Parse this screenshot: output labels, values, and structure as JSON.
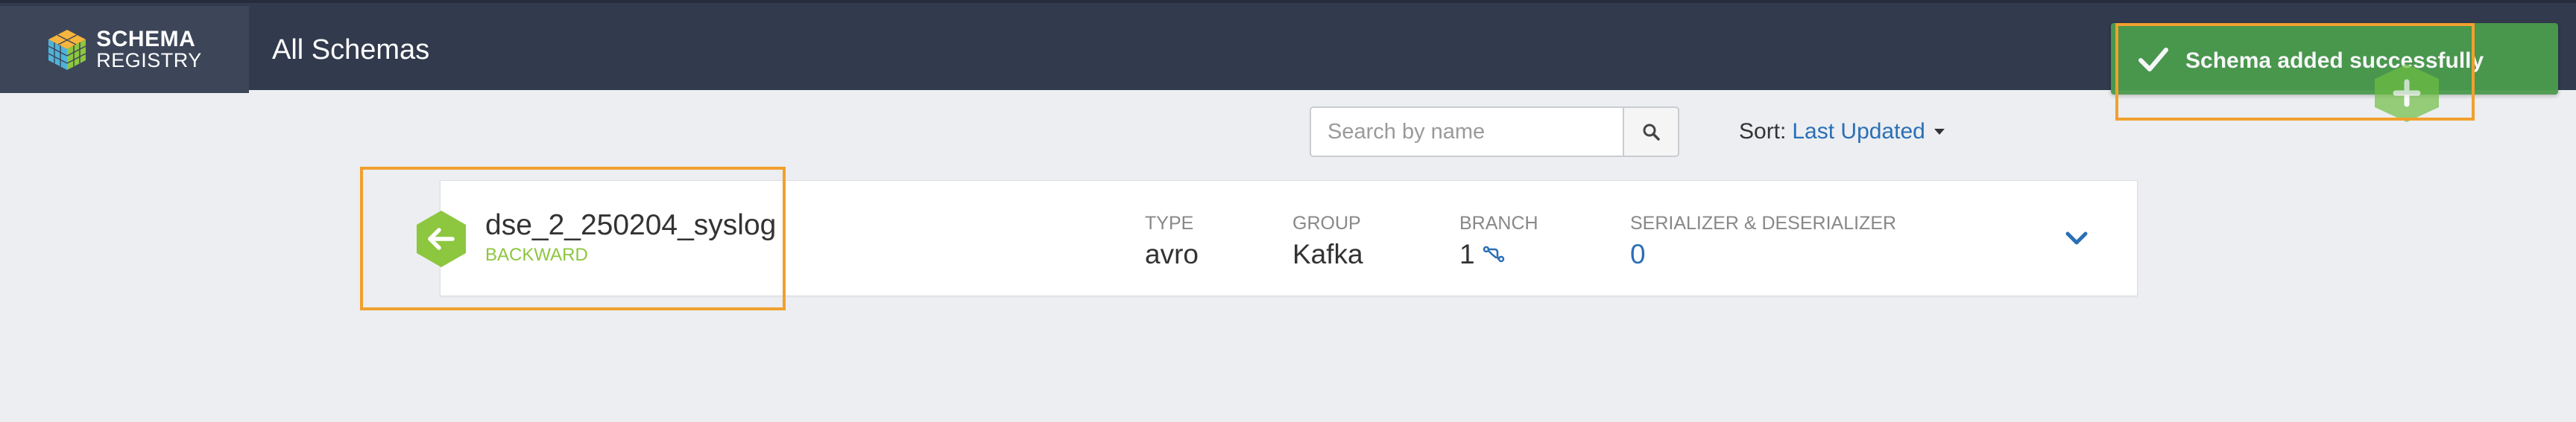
{
  "header": {
    "logo": {
      "line1": "SCHEMA",
      "line2": "REGISTRY",
      "icon": "cube-logo-icon"
    },
    "title": "All Schemas"
  },
  "toast": {
    "message": "Schema added successfully",
    "icon": "check-icon",
    "color": "#4a9a4d"
  },
  "toolbar": {
    "search": {
      "placeholder": "Search by name",
      "value": "",
      "icon": "search-icon"
    },
    "sort": {
      "label": "Sort:",
      "value": "Last Updated",
      "icon": "caret-down-icon"
    }
  },
  "schemas": [
    {
      "name": "dse_2_250204_syslog",
      "compatibility": "BACKWARD",
      "icon": "arrow-left-hex-icon",
      "fields": {
        "type": {
          "label": "TYPE",
          "value": "avro"
        },
        "group": {
          "label": "GROUP",
          "value": "Kafka"
        },
        "branch": {
          "label": "BRANCH",
          "value": "1",
          "icon": "branch-icon"
        },
        "serde": {
          "label": "SERIALIZER & DESERIALIZER",
          "value": "0"
        }
      }
    }
  ],
  "colors": {
    "header_bg": "#323a4d",
    "logo_bg": "#3d4659",
    "page_bg": "#eceef1",
    "accent_green": "#8dc63f",
    "link_blue": "#2a6fb5",
    "highlight_orange": "#f1a02e"
  }
}
